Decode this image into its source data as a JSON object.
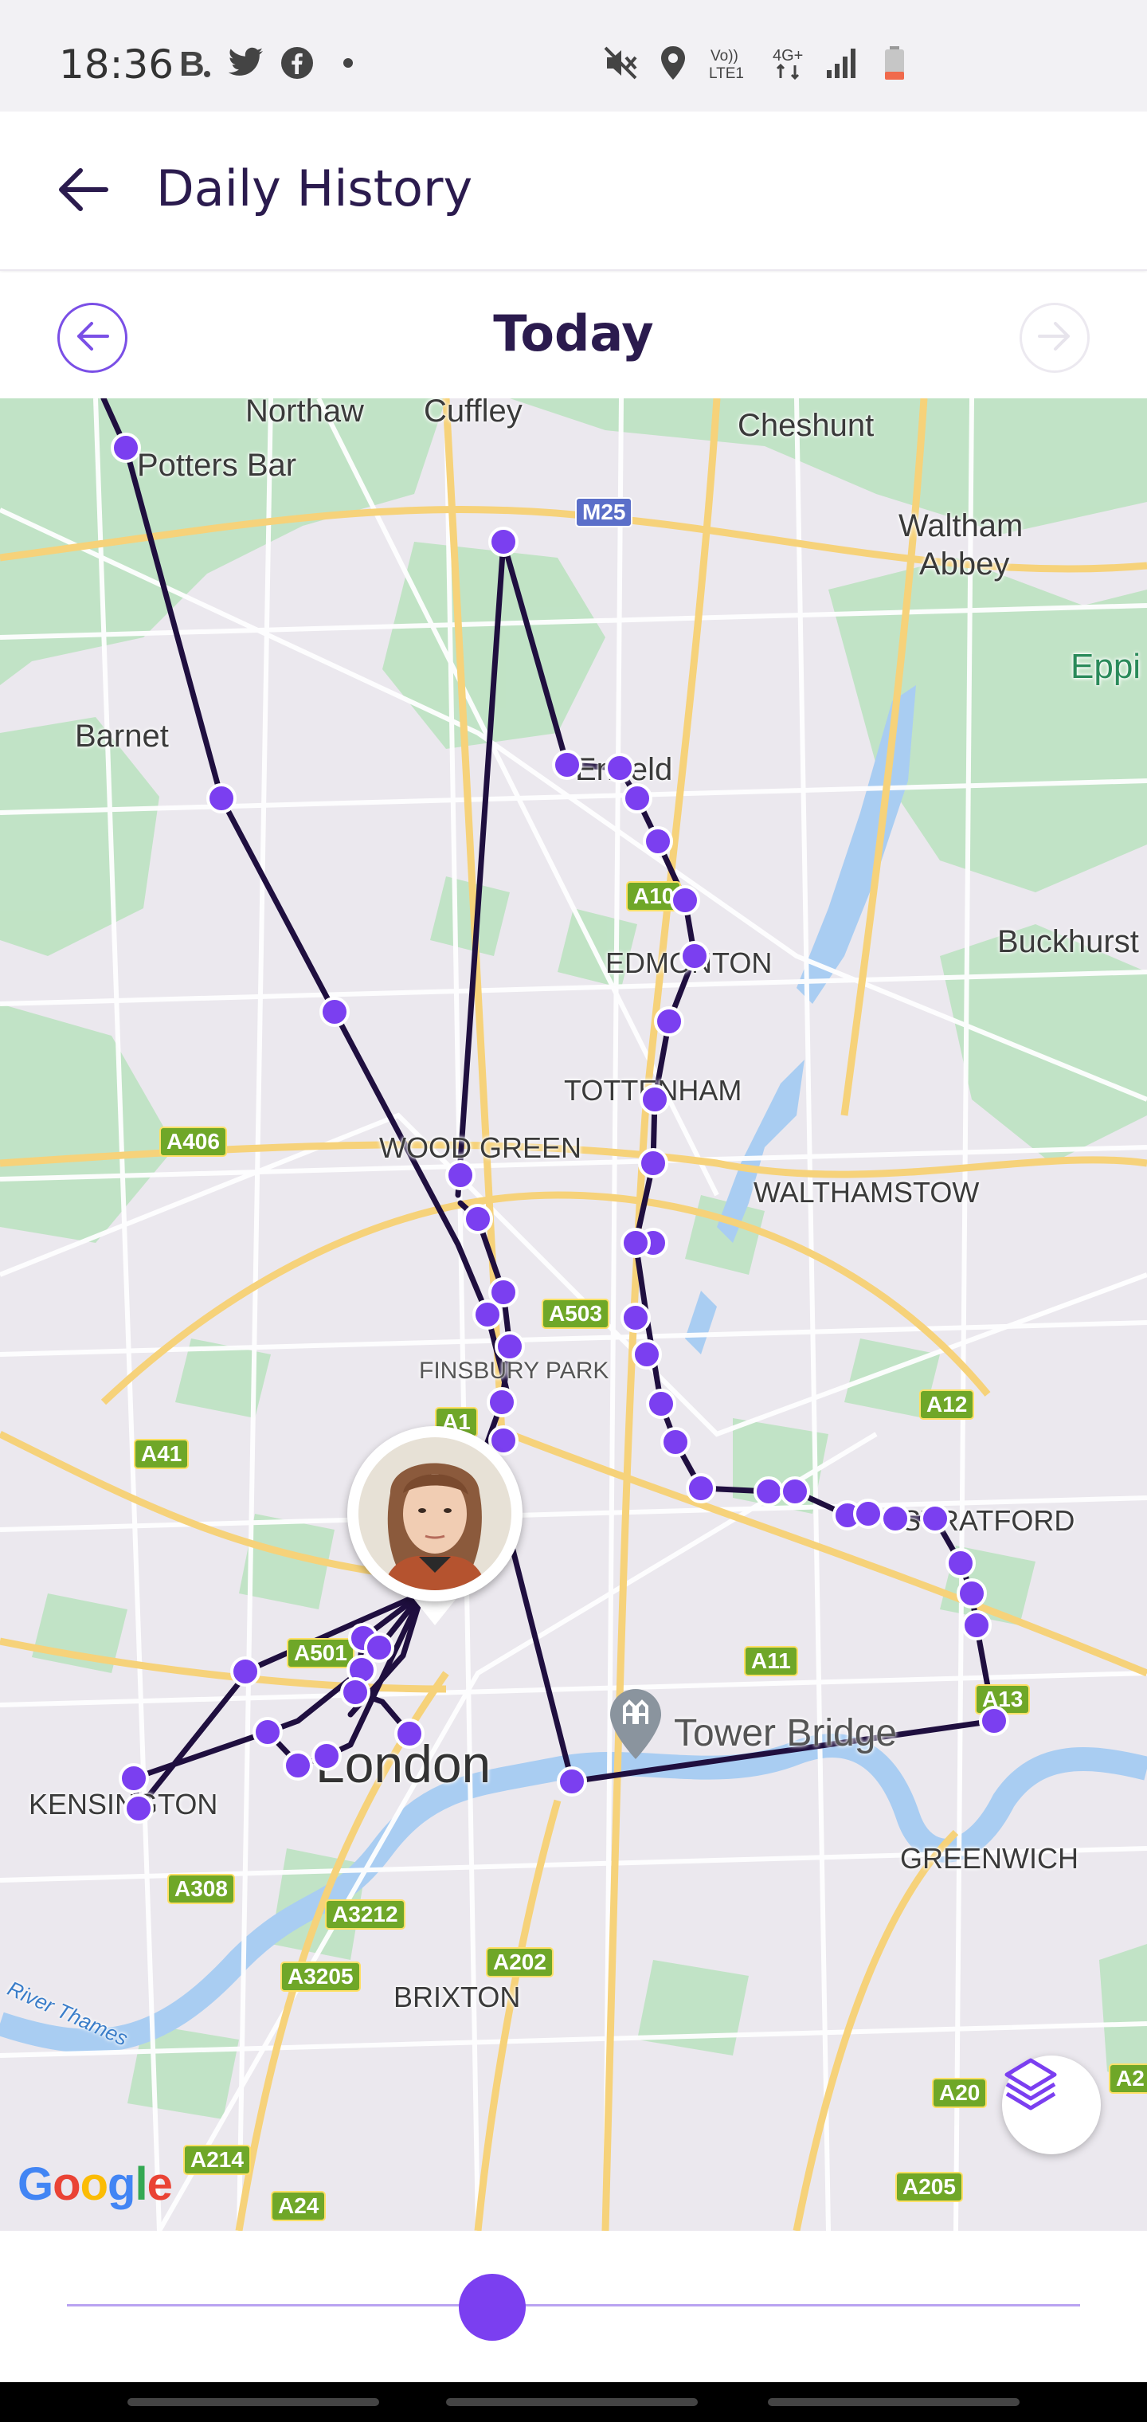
{
  "status_bar": {
    "time": "18:36",
    "notification_icons": [
      "booking-icon",
      "twitter-icon",
      "facebook-icon",
      "dot-icon"
    ],
    "system_icons": [
      "mute-icon",
      "location-icon",
      "volte-icon",
      "4g-icon",
      "signal-icon",
      "battery-icon"
    ],
    "volte_label": "Vo)) LTE1",
    "network_label": "4G+"
  },
  "app_bar": {
    "title": "Daily History"
  },
  "day_nav": {
    "title": "Today"
  },
  "map": {
    "place_labels": [
      "Northaw",
      "Cuffley",
      "Cheshunt",
      "Potters Bar",
      "Waltham",
      "Abbey",
      "Eppi",
      "Barnet",
      "Enfield",
      "EDMONTON",
      "Buckhurst",
      "TOTTENHAM",
      "WOOD GREEN",
      "WALTHAMSTOW",
      "FINSBURY PARK",
      "STRATFORD",
      "KENSINGTON",
      "GREENWICH",
      "BRIXTON"
    ],
    "city_label": "London",
    "landmark_label": "Tower Bridge",
    "river_label": "River Thames",
    "road_shields": [
      "M25",
      "A10",
      "A406",
      "A503",
      "A12",
      "A41",
      "A1",
      "A501",
      "A11",
      "A13",
      "A308",
      "A3212",
      "A3205",
      "A202",
      "A20",
      "A2",
      "A214",
      "A24",
      "A205"
    ],
    "attribution": "Google",
    "route_color": "#1f0f3f",
    "point_color": "#7b3ff0",
    "layers_button": "layers-icon"
  },
  "timeline": {
    "position": 0.42
  }
}
